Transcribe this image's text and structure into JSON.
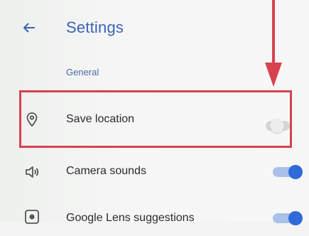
{
  "header": {
    "title": "Settings",
    "back_icon": "arrow-back-icon"
  },
  "section": {
    "title": "General"
  },
  "settings": [
    {
      "label": "Save location",
      "icon": "location-pin-icon",
      "enabled": false
    },
    {
      "label": "Camera sounds",
      "icon": "volume-icon",
      "enabled": true
    },
    {
      "label": "Google Lens suggestions",
      "icon": "lens-icon",
      "enabled": true
    }
  ],
  "annotation": {
    "highlighted_item": "Save location",
    "color": "#d8424f"
  },
  "colors": {
    "accent": "#3b63b6",
    "toggle_on": "#2f6ad9"
  }
}
